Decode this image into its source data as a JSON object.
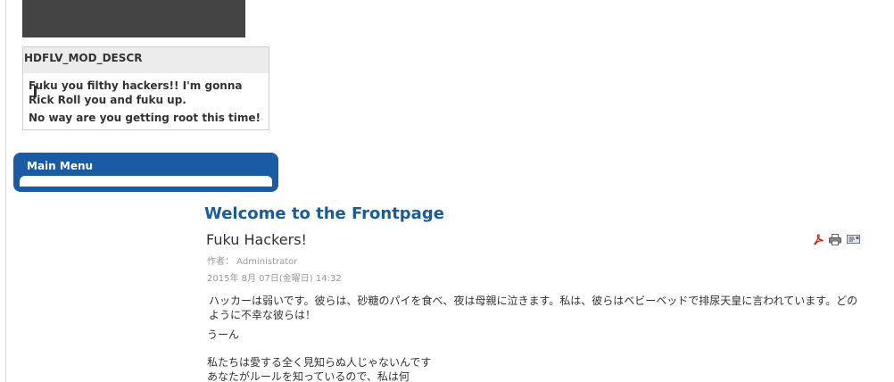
{
  "hdflv_module": {
    "heading": "HDFLV_MOD_DESCR",
    "line1": "Fuku you filthy hackers!! I'm gonna Rick Roll you and fuku up.",
    "line2": "No way are you getting root this time!"
  },
  "main_menu": {
    "title": "Main Menu"
  },
  "component": {
    "heading": "Welcome to the Frontpage"
  },
  "article": {
    "title": "Fuku Hackers!",
    "author": "作者： Administrator",
    "date": "2015年 8月 07日(金曜日) 14:32",
    "paragraph1": "ハッカーは弱いです。彼らは、砂糖のパイを食べ、夜は母親に泣きます。私は、彼らはベビーベッドで排尿天皇に言われています。どのように不幸な彼らは！",
    "paragraph2": "うーん",
    "paragraph3_line1": "私たちは愛する全く見知らぬ人じゃないんです",
    "paragraph3_line2": "あなたがルールを知っているので、私は何",
    "icons": [
      "pdf-icon",
      "print-icon",
      "email-icon"
    ]
  },
  "colors": {
    "menu_blue": "#1a5ba6",
    "heading_blue": "#1a5b99",
    "video_box": "#444444"
  }
}
